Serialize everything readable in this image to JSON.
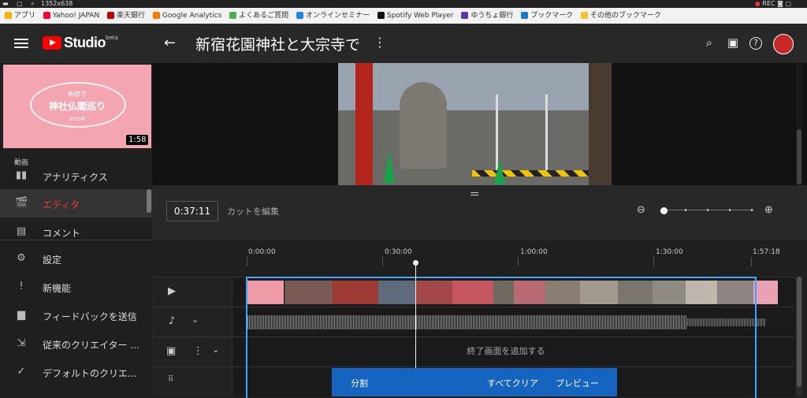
{
  "recorder": {
    "size": "1352x638",
    "rec_label": "REC"
  },
  "bookmarks": [
    {
      "label": "アプリ",
      "color": "#f4b400"
    },
    {
      "label": "Yahoo! JAPAN",
      "color": "#ff0033"
    },
    {
      "label": "楽天銀行",
      "color": "#bf0000"
    },
    {
      "label": "Google Analytics",
      "color": "#f57c00"
    },
    {
      "label": "よくあるご質問",
      "color": "#4caf50"
    },
    {
      "label": "オンラインセミナー",
      "color": "#1e88e5"
    },
    {
      "label": "Spotify Web Player",
      "color": "#111111"
    },
    {
      "label": "ゆうちょ銀行",
      "color": "#5e35b1"
    },
    {
      "label": "ブックマーク",
      "color": "#1976d2"
    },
    {
      "label": "その他のブックマーク",
      "color": "#fbc02d"
    }
  ],
  "header": {
    "studio_label": "Studio",
    "beta_label": "beta",
    "back_icon": "←",
    "video_title": "新宿花園神社と大宗寺で",
    "more_icon": "⋮",
    "search_icon": "⌕",
    "create_icon": "▣",
    "help_icon": "?"
  },
  "sidebar": {
    "thumbnail": {
      "line1": "新宿で",
      "line2": "神社仏閣巡り",
      "line3": "2023年",
      "duration": "1:58"
    },
    "section_label": "動画",
    "items": [
      {
        "label": "アナリティクス",
        "icon": "▮▮"
      },
      {
        "label": "エディタ",
        "icon": "🎬"
      },
      {
        "label": "コメント",
        "icon": "▤"
      },
      {
        "label": "設定",
        "icon": "⚙"
      },
      {
        "label": "新機能",
        "icon": "!"
      },
      {
        "label": "フィードバックを送信",
        "icon": "▆"
      },
      {
        "label": "従来のクリエイター ...",
        "icon": "⇲"
      },
      {
        "label": "デフォルトのクリエ...",
        "icon": "✓"
      }
    ]
  },
  "editor": {
    "current_time": "0:37:11",
    "cut_edit_label": "カットを編集",
    "zoom_out_icon": "⊖",
    "zoom_in_icon": "⊕",
    "ruler_ticks": [
      "0:00:00",
      "0:30:00",
      "1:00:00",
      "1:30:00",
      "1:57:18"
    ],
    "end_screen_label": "終了画面を追加する",
    "actions": {
      "split": "分割",
      "clear_all": "すべてクリア",
      "preview": "プレビュー"
    }
  }
}
